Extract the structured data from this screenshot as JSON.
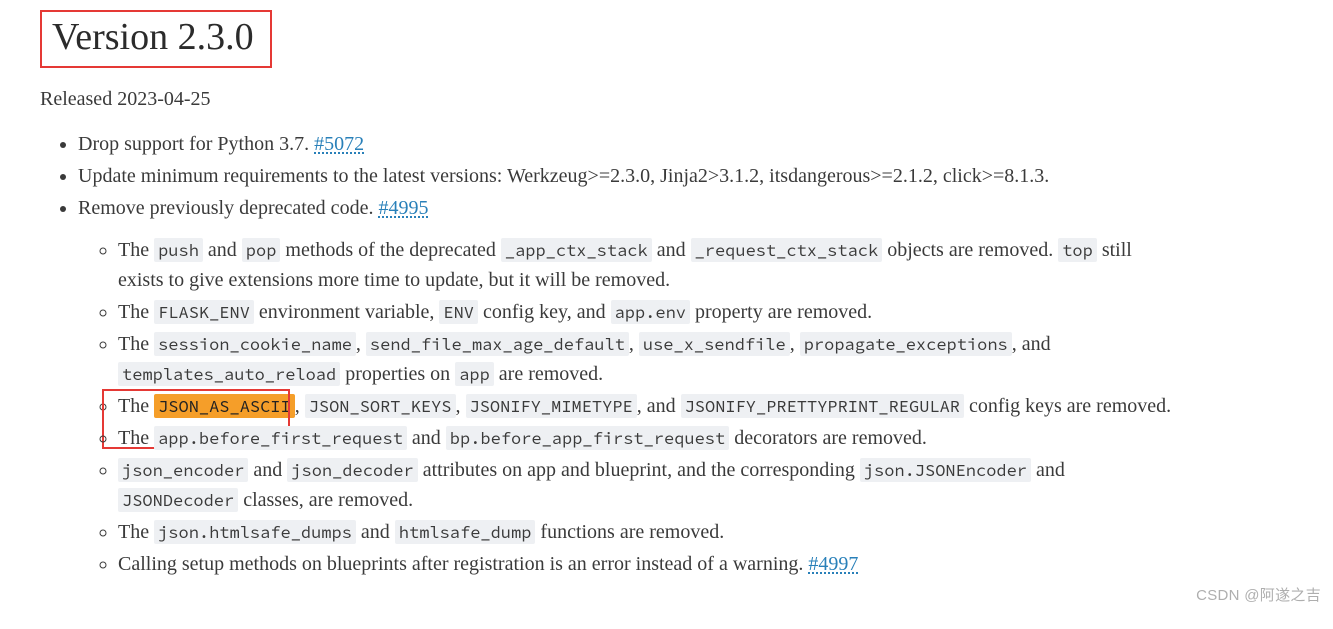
{
  "heading": "Version 2.3.0",
  "released": "Released 2023-04-25",
  "link5072": "#5072",
  "link4995": "#4995",
  "link4997": "#4997",
  "top": {
    "drop37_a": "Drop support for Python 3.7. ",
    "update_min": "Update minimum requirements to the latest versions: Werkzeug>=2.3.0, Jinja2>3.1.2, itsdangerous>=2.1.2, click>=8.1.3.",
    "remove_dep_a": "Remove previously deprecated code. "
  },
  "sub": {
    "i1_a": "The ",
    "i1_push": "push",
    "i1_b": " and ",
    "i1_pop": "pop",
    "i1_c": " methods of the deprecated ",
    "i1_appctx": "_app_ctx_stack",
    "i1_d": " and ",
    "i1_reqctx": "_request_ctx_stack",
    "i1_e": " objects are removed. ",
    "i1_top": "top",
    "i1_f": " still exists to give extensions more time to update, but it will be removed.",
    "i2_a": "The ",
    "i2_flaskenv": "FLASK_ENV",
    "i2_b": " environment variable, ",
    "i2_envkey": "ENV",
    "i2_c": " config key, and ",
    "i2_appenv": "app.env",
    "i2_d": " property are removed.",
    "i3_a": "The ",
    "i3_sessioncookie": "session_cookie_name",
    "i3_b": ", ",
    "i3_sendfile": "send_file_max_age_default",
    "i3_c": ", ",
    "i3_usex": "use_x_sendfile",
    "i3_d": ", ",
    "i3_propexc": "propagate_exceptions",
    "i3_e": ", and ",
    "i3_templates": "templates_auto_reload",
    "i3_f": " properties on ",
    "i3_app": "app",
    "i3_g": " are removed.",
    "i4_a": "The ",
    "i4_jsonascii": "JSON_AS_ASCII",
    "i4_b": ", ",
    "i4_jsonsort": "JSON_SORT_KEYS",
    "i4_c": ", ",
    "i4_jsonmime": "JSONIFY_MIMETYPE",
    "i4_d": ", and ",
    "i4_jsonpp": "JSONIFY_PRETTYPRINT_REGULAR",
    "i4_e": " config keys are removed.",
    "i5_a": "The ",
    "i5_appbefore": "app.before_first_request",
    "i5_b": " and ",
    "i5_bpbefore": "bp.before_app_first_request",
    "i5_c": " decorators are removed.",
    "i6_a": "json_encoder",
    "i6_b": " and ",
    "i6_c": "json_decoder",
    "i6_d": " attributes on app and blueprint, and the corresponding ",
    "i6_e": "json.JSONEncoder",
    "i6_f": " and ",
    "i6_g": "JSONDecoder",
    "i6_h": " classes, are removed.",
    "i7_a": "The ",
    "i7_b": "json.htmlsafe_dumps",
    "i7_c": " and ",
    "i7_d": "htmlsafe_dump",
    "i7_e": " functions are removed.",
    "i8_a": "Calling setup methods on blueprints after registration is an error instead of a warning. "
  },
  "watermark": "CSDN @阿遂之吉"
}
